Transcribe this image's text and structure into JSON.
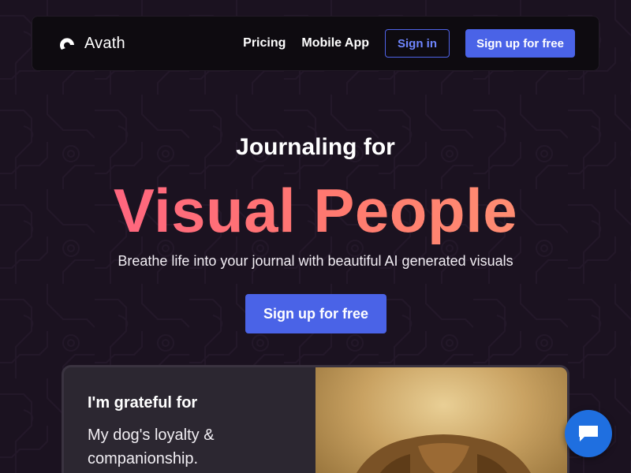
{
  "nav": {
    "brand": "Avath",
    "links": [
      "Pricing",
      "Mobile App"
    ],
    "signin_label": "Sign in",
    "signup_label": "Sign up for free"
  },
  "hero": {
    "kicker": "Journaling for",
    "title": "Visual People",
    "subtitle": "Breathe life into your journal with beautiful AI generated visuals",
    "cta_label": "Sign up for free"
  },
  "card": {
    "heading": "I'm grateful for",
    "body": "My dog's loyalty & companionship."
  },
  "icons": {
    "brand": "avath-logo-icon",
    "chat": "chat-bubble-icon"
  },
  "colors": {
    "background": "#1b1220",
    "accent": "#4a63e7",
    "title_gradient_start": "#ff5c86",
    "title_gradient_end": "#ff9a74",
    "chat": "#1f6fe0"
  }
}
